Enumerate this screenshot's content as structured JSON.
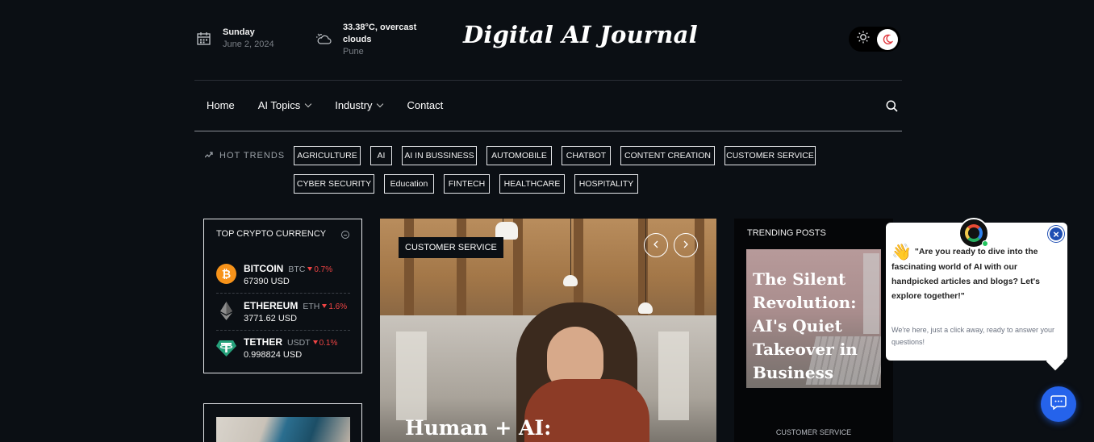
{
  "header": {
    "date": {
      "day": "Sunday",
      "full": "June 2, 2024",
      "icon": "calendar-icon"
    },
    "weather": {
      "summary": "33.38°C, overcast clouds",
      "city": "Pune",
      "icon": "cloud-sun-icon"
    },
    "logo": "Digital AI Journal",
    "theme_toggle": {
      "light_icon": "sun-icon",
      "dark_icon": "moon-icon",
      "active": "dark"
    }
  },
  "nav": {
    "items": [
      {
        "label": "Home",
        "dropdown": false
      },
      {
        "label": "AI Topics",
        "dropdown": true
      },
      {
        "label": "Industry",
        "dropdown": true
      },
      {
        "label": "Contact",
        "dropdown": false
      }
    ],
    "search_icon": "search-icon"
  },
  "hot_trends": {
    "label": "HOT TRENDS",
    "icon": "trending-icon",
    "tags": [
      "AGRICULTURE",
      "AI",
      "AI IN BUSSINESS",
      "AUTOMOBILE",
      "CHATBOT",
      "CONTENT CREATION",
      "CUSTOMER SERVICE",
      "CYBER SECURITY",
      "Education",
      "FINTECH",
      "HEALTHCARE",
      "HOSPITALITY"
    ]
  },
  "crypto": {
    "title": "TOP CRYPTO CURRENCY",
    "coins": [
      {
        "name": "BITCOIN",
        "symbol": "BTC",
        "change": "0.7%",
        "direction": "down",
        "price": "67390 USD",
        "color": "#f7931a"
      },
      {
        "name": "ETHEREUM",
        "symbol": "ETH",
        "change": "1.6%",
        "direction": "down",
        "price": "3771.62 USD",
        "color": "#8c8c8c"
      },
      {
        "name": "TETHER",
        "symbol": "USDT",
        "change": "0.1%",
        "direction": "down",
        "price": "0.998824 USD",
        "color": "#26a17b"
      }
    ]
  },
  "hero": {
    "category": "CUSTOMER SERVICE",
    "title": "Human + AI:"
  },
  "trending": {
    "heading": "TRENDING POSTS",
    "title": "The Silent Revolution: AI's Quiet Takeover in Business",
    "category": "CUSTOMER SERVICE"
  },
  "chat": {
    "message": "\"Are you ready to dive into the fascinating world of AI with our handpicked articles and blogs? Let's explore together!\"",
    "subtext": "We're here, just a click away, ready to answer your questions!",
    "wave_emoji": "👋",
    "close_label": "×",
    "accent": "#2563eb"
  },
  "colors": {
    "background": "#0b0f14",
    "accent": "#2563eb",
    "negative": "#ef4444"
  }
}
